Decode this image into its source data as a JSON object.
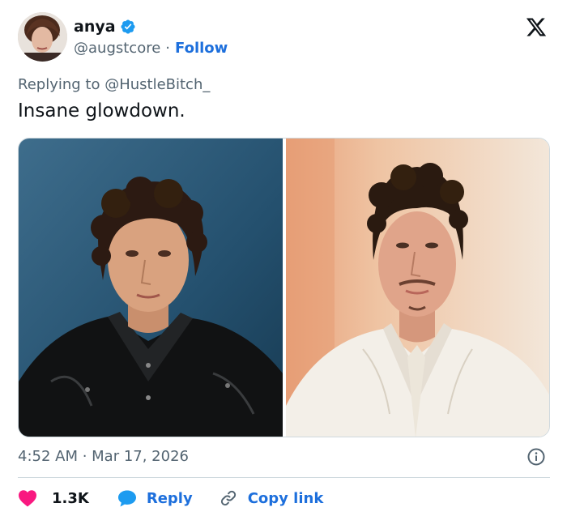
{
  "author": {
    "display_name": "anya",
    "handle": "@augstcore",
    "separator": "·",
    "follow_label": "Follow"
  },
  "tweet": {
    "replying_to": "Replying to @HustleBitch_",
    "text": "Insane glowdown.",
    "timestamp": "4:52 AM · Mar 17, 2026"
  },
  "actions": {
    "likes_count": "1.3K",
    "reply_label": "Reply",
    "copy_link_label": "Copy link"
  },
  "colors": {
    "accent": "#1d6fdc",
    "like_heart": "#f91880",
    "reply_bubble": "#1d9bf0",
    "muted_text": "#536471",
    "divider": "#cfd9de"
  },
  "icons": {
    "verified": "verified-badge-icon",
    "brand": "x-logo-icon",
    "info": "info-icon",
    "like": "heart-icon",
    "reply": "speech-bubble-icon",
    "copy": "link-icon"
  }
}
